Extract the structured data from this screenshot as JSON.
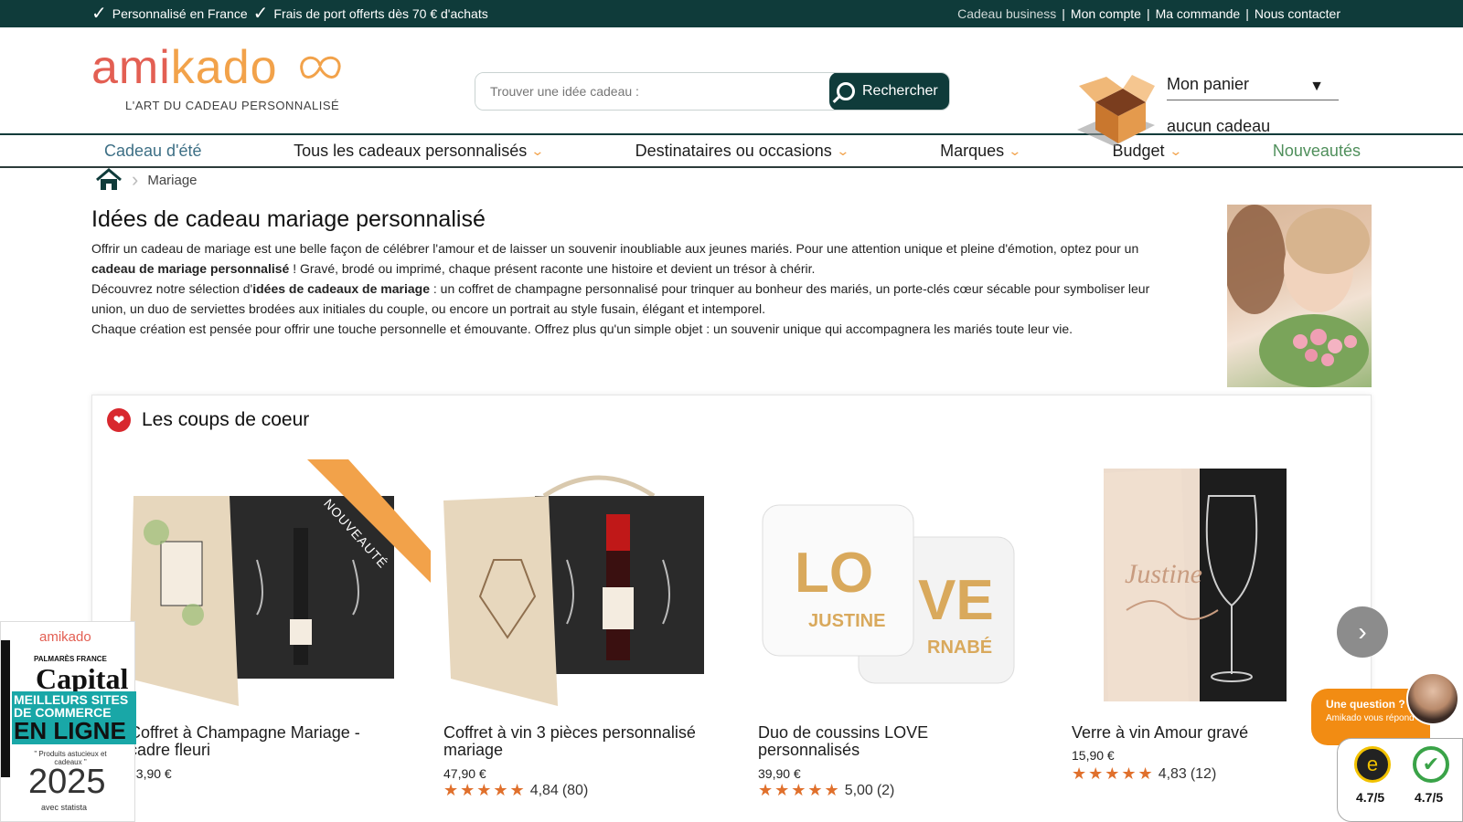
{
  "topbar": {
    "promo1": "Personnalisé en France",
    "promo2": "Frais de port offerts dès 70 € d'achats",
    "links": {
      "business": "Cadeau business",
      "account": "Mon compte",
      "order": "Ma commande",
      "contact": "Nous contacter"
    }
  },
  "logo": {
    "text_a": "ami",
    "text_k": "kado",
    "tagline": "L'ART DU CADEAU PERSONNALISÉ"
  },
  "search": {
    "placeholder": "Trouver une idée cadeau :",
    "button": "Rechercher"
  },
  "cart": {
    "title": "Mon panier",
    "status": "aucun cadeau"
  },
  "nav": {
    "summer": "Cadeau d'été",
    "all": "Tous les cadeaux personnalisés",
    "recipients": "Destinataires ou occasions",
    "brands": "Marques",
    "budget": "Budget",
    "new": "Nouveautés"
  },
  "breadcrumb": {
    "current": "Mariage"
  },
  "intro": {
    "title": "Idées de cadeau mariage personnalisé",
    "p1a": "Offrir un cadeau de mariage est une belle façon de célébrer l'amour et de laisser un souvenir inoubliable aux jeunes mariés. Pour une attention unique et pleine d'émotion, optez pour un ",
    "p1b": "cadeau de mariage personnalisé",
    "p1c": " ! Gravé, brodé ou imprimé, chaque présent raconte une histoire et devient un trésor à chérir.",
    "p2a": "Découvrez notre sélection d'",
    "p2b": "idées de cadeaux de mariage",
    "p2c": " : un coffret de champagne personnalisé pour trinquer au bonheur des mariés, un porte-clés cœur sécable pour symboliser leur union, un duo de serviettes brodées aux initiales du couple, ou encore un portrait au style fusain, élégant et intemporel.",
    "p3": "Chaque création est pensée pour offrir une touche personnelle et émouvante. Offrez plus qu'un simple objet : un souvenir unique qui accompagnera les mariés toute leur vie."
  },
  "coups": {
    "title": "Les coups de coeur",
    "products": [
      {
        "name": "Coffret à Champagne Mariage - cadre fleuri",
        "price": "83,90 €",
        "badge": "NOUVEAUTÉ"
      },
      {
        "name": "Coffret à vin 3 pièces personnalisé mariage",
        "price": "47,90 €",
        "stars": "★★★★★",
        "rating": "4,84",
        "count": "(80)"
      },
      {
        "name": "Duo de coussins LOVE personnalisés",
        "price": "39,90 €",
        "stars": "★★★★★",
        "rating": "5,00",
        "count": "(2)"
      },
      {
        "name": "Verre à vin Amour gravé",
        "price": "15,90 €",
        "stars": "★★★★★",
        "rating": "4,83",
        "count": "(12)"
      }
    ]
  },
  "badge": {
    "brand": "amikado",
    "palmares": "PALMARÈS FRANCE",
    "magazine": "Capital",
    "best1": "MEILLEURS SITES",
    "best2": "DE COMMERCE",
    "best3": "EN LIGNE",
    "quote": "\" Produits astucieux et cadeaux \"",
    "year": "2025",
    "statista": "avec statista"
  },
  "chat": {
    "line1": "Une question ?",
    "line2": "Amikado vous répond !"
  },
  "trust": {
    "score1": "4.7/5",
    "score2": "4.7/5"
  },
  "colors": {
    "brand_dark": "#0f3b3a",
    "brand_orange": "#f2a24a",
    "brand_red": "#e35f53",
    "star": "#e0702c"
  }
}
